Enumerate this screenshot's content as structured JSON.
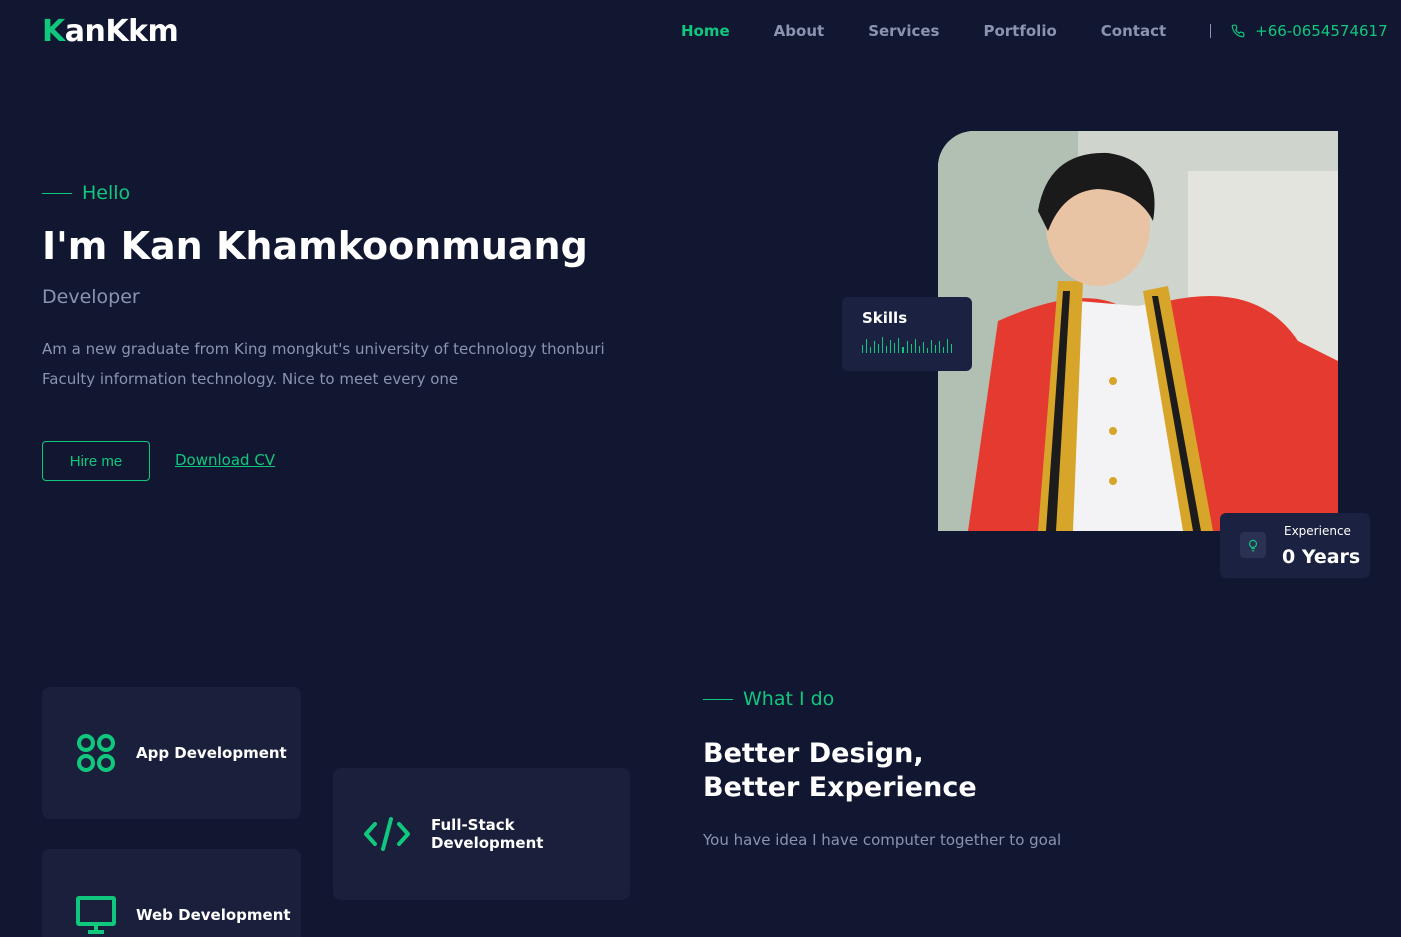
{
  "brand": {
    "logo_first": "K",
    "logo_rest": "anKkm"
  },
  "nav": {
    "items": [
      "Home",
      "About",
      "Services",
      "Portfolio",
      "Contact"
    ],
    "active": "Home",
    "phone": "+66-0654574617"
  },
  "hero": {
    "greeting": "Hello",
    "title": "I'm Kan Khamkoonmuang",
    "role": "Developer",
    "description": "Am a new graduate from King mongkut's university of technology thonburi Faculty information technology. Nice to meet every one",
    "hire_label": "Hire me",
    "cv_label": "Download CV"
  },
  "skills_card": {
    "label": "Skills"
  },
  "experience_card": {
    "label": "Experience",
    "value": "0 Years"
  },
  "services": {
    "items": [
      {
        "title": "App Development",
        "icon": "app-grid-icon"
      },
      {
        "title": "Full-Stack Development",
        "icon": "code-icon"
      },
      {
        "title": "Web Development",
        "icon": "monitor-icon"
      }
    ]
  },
  "what_i_do": {
    "eyebrow": "What I do",
    "title_line1": "Better Design,",
    "title_line2": "Better Experience",
    "description": "You have idea I have computer together to goal"
  },
  "colors": {
    "background": "#111631",
    "accent": "#10c77e",
    "muted": "#8b93b0",
    "card": "#1a1f3b"
  }
}
